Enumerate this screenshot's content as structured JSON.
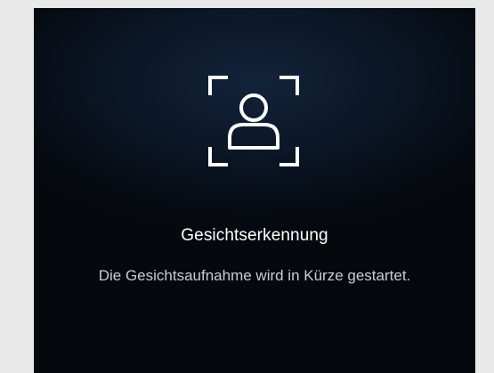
{
  "screen": {
    "icon": "face-scan-icon",
    "title": "Gesichtserkennung",
    "message": "Die Gesichtsaufnahme wird in Kürze gestartet."
  },
  "colors": {
    "outer_background": "#e9e9e9",
    "panel_background": "#060b12",
    "title_text": "#ffffff",
    "message_text": "#c9ccd1"
  }
}
